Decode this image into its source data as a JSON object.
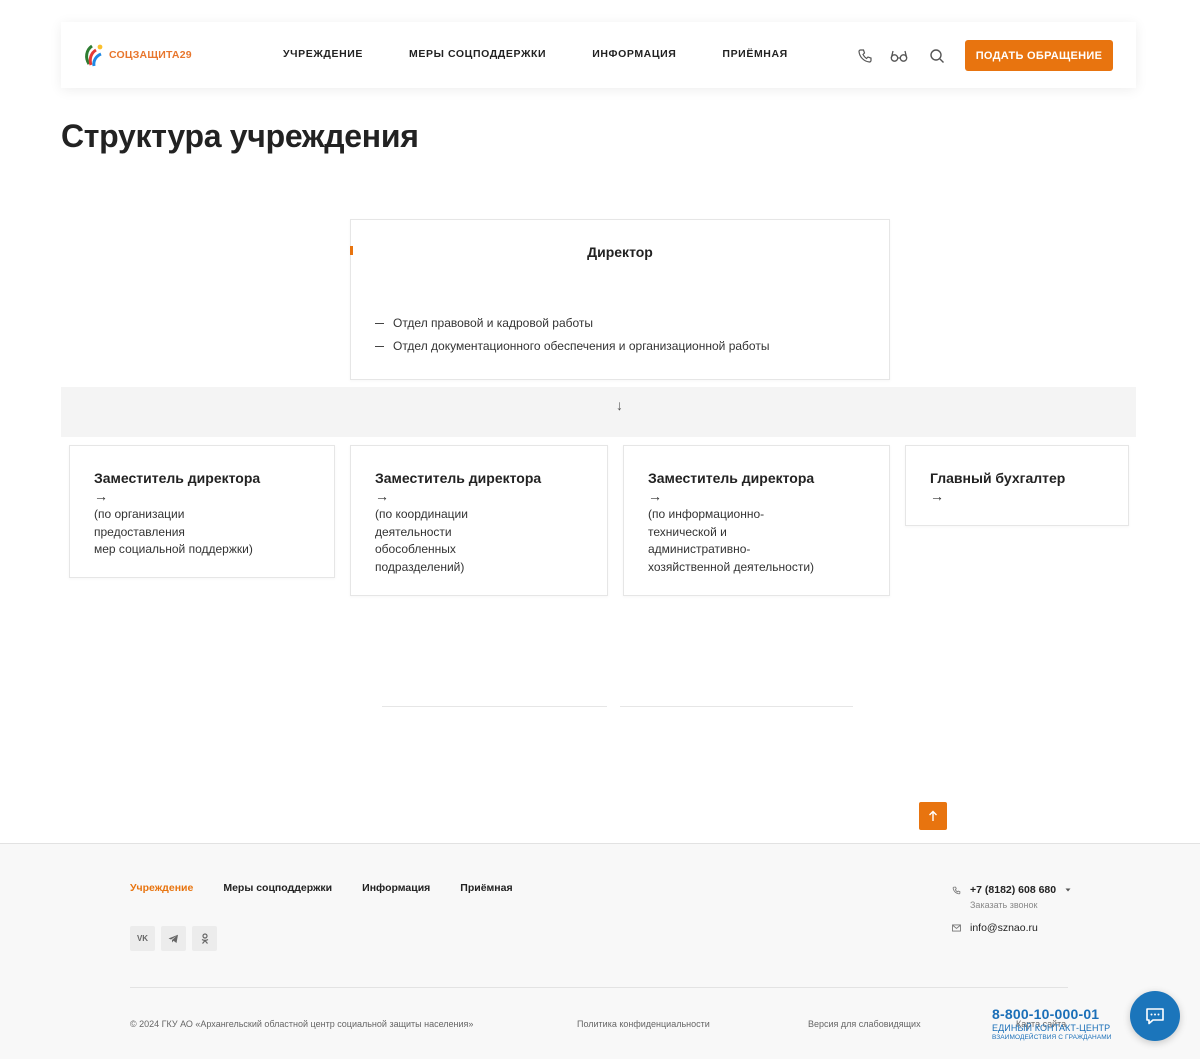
{
  "header": {
    "logo_text": "СОЦЗАЩИТА29",
    "nav": [
      "УЧРЕЖДЕНИЕ",
      "МЕРЫ СОЦПОДДЕРЖКИ",
      "ИНФОРМАЦИЯ",
      "ПРИЁМНАЯ"
    ],
    "icons": [
      "phone-icon",
      "low-vision-glasses-icon",
      "search-icon"
    ],
    "cta_label": "ПОДАТЬ ОБРАЩЕНИЕ"
  },
  "page_title": "Структура учреждения",
  "director": {
    "title": "Директор",
    "departments": [
      "Отдел правовой и кадровой работы",
      "Отдел документационного обеспечения и организационной работы"
    ]
  },
  "down_arrow": "↓",
  "deputies": [
    {
      "title": "Заместитель директора",
      "arrow": "→",
      "desc": "(по организации\nпредоставления\nмер социальной поддержки)"
    },
    {
      "title": "Заместитель директора",
      "arrow": "→",
      "desc": "(по координации\nдеятельности\nобособленных\nподразделений)"
    },
    {
      "title": "Заместитель директора",
      "arrow": "→",
      "desc": "(по информационно-\nтехнической и\nадминистративно-\nхозяйственной деятельности)"
    },
    {
      "title": "Главный бухгалтер",
      "arrow": "→",
      "desc": ""
    }
  ],
  "footer": {
    "nav": [
      "Учреждение",
      "Меры соцподдержки",
      "Информация",
      "Приёмная"
    ],
    "active_nav": "Учреждение",
    "socials": [
      "VK",
      "TG",
      "OK"
    ],
    "phone": "+7 (8182) 608 680",
    "callback": "Заказать звонок",
    "email": "info@sznao.ru",
    "copyright": "© 2024 ГКУ АО «Архангельский областной центр социальной защиты населения»",
    "privacy": "Политика конфиденциальности",
    "low_vision": "Версия для слабовидящих",
    "sitemap": "Карта сайта",
    "hotline": {
      "number": "8-800-10-000-01",
      "line1": "ЕДИНЫЙ КОНТАКТ-ЦЕНТР",
      "line2": "ВЗАИМОДЕЙСТВИЯ С ГРАЖДАНАМИ"
    }
  },
  "colors": {
    "accent": "#e8740f",
    "hotline_blue": "#1a6fb8",
    "chat_blue": "#1b75bb"
  }
}
